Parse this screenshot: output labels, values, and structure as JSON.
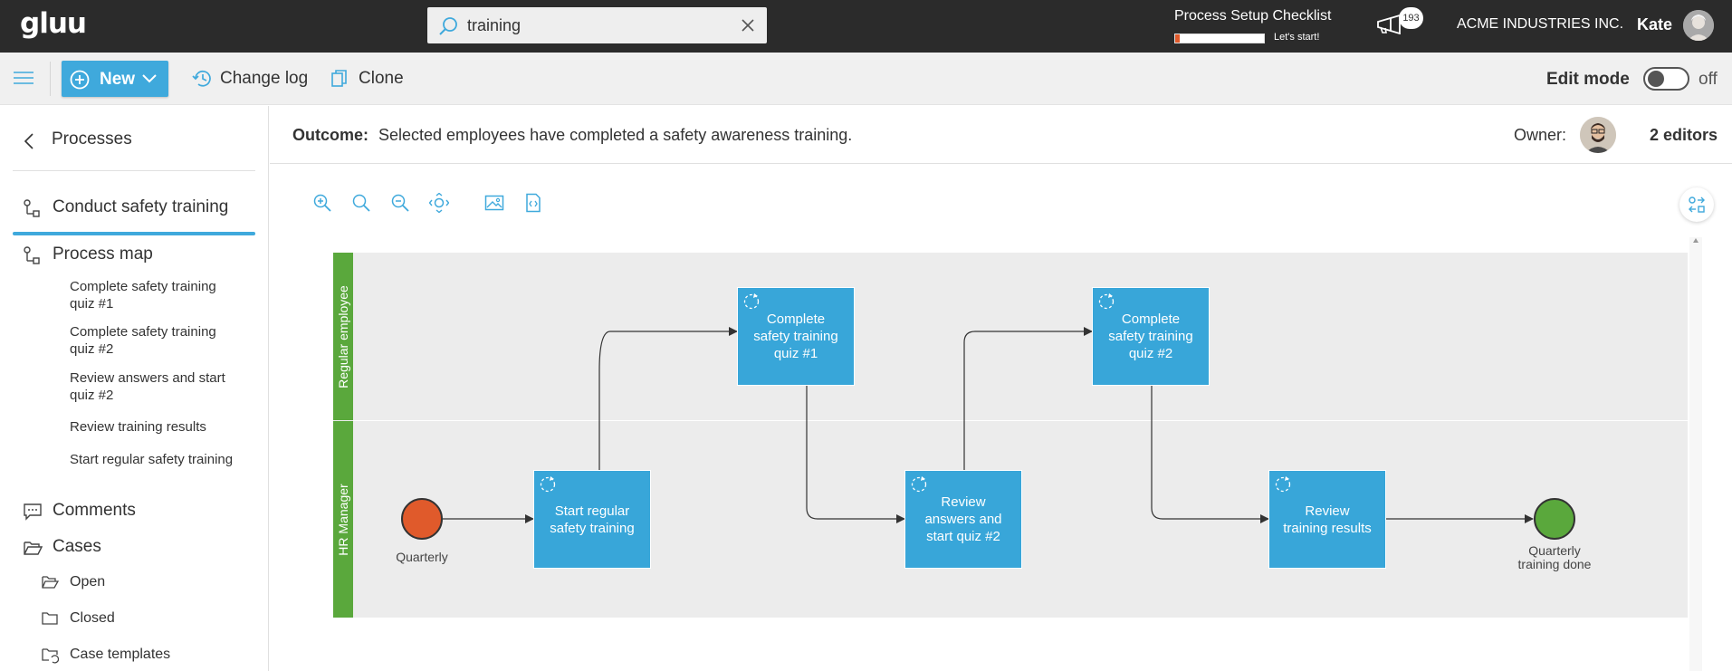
{
  "topbar": {
    "logo": "gluu",
    "search_value": "training",
    "checklist_title": "Process Setup Checklist",
    "checklist_progress_pct": 5,
    "checklist_cta": "Let's start!",
    "notification_count": "193",
    "company": "ACME INDUSTRIES INC.",
    "user_name": "Kate"
  },
  "toolbar": {
    "new_label": "New",
    "changelog_label": "Change log",
    "clone_label": "Clone",
    "edit_mode_label": "Edit mode",
    "edit_mode_state": "off"
  },
  "sidebar": {
    "back_label": "Processes",
    "active_label": "Conduct safety training",
    "process_map_label": "Process map",
    "process_map_items": [
      "Complete safety training quiz #1",
      "Complete safety training quiz #2",
      "Review answers and start quiz #2",
      "Review training results",
      "Start regular safety training"
    ],
    "comments_label": "Comments",
    "cases_label": "Cases",
    "cases_items": [
      "Open",
      "Closed",
      "Case templates"
    ]
  },
  "outcome": {
    "label": "Outcome:",
    "text": "Selected employees have completed a safety awareness training.",
    "owner_label": "Owner:",
    "editors_label": "2 editors"
  },
  "diagram": {
    "lanes": [
      "Regular employee",
      "HR Manager"
    ],
    "tasks": [
      "Start regular safety training",
      "Complete safety training quiz #1",
      "Review answers and start quiz #2",
      "Complete safety training quiz #2",
      "Review training results"
    ],
    "start_event_label": "Quarterly",
    "end_event_label_line1": "Quarterly",
    "end_event_label_line2": "training done",
    "colors": {
      "task": "#38a6d9",
      "lane": "#5aa83c",
      "start_event": "#e05a2b",
      "end_event": "#5aa83c"
    }
  }
}
